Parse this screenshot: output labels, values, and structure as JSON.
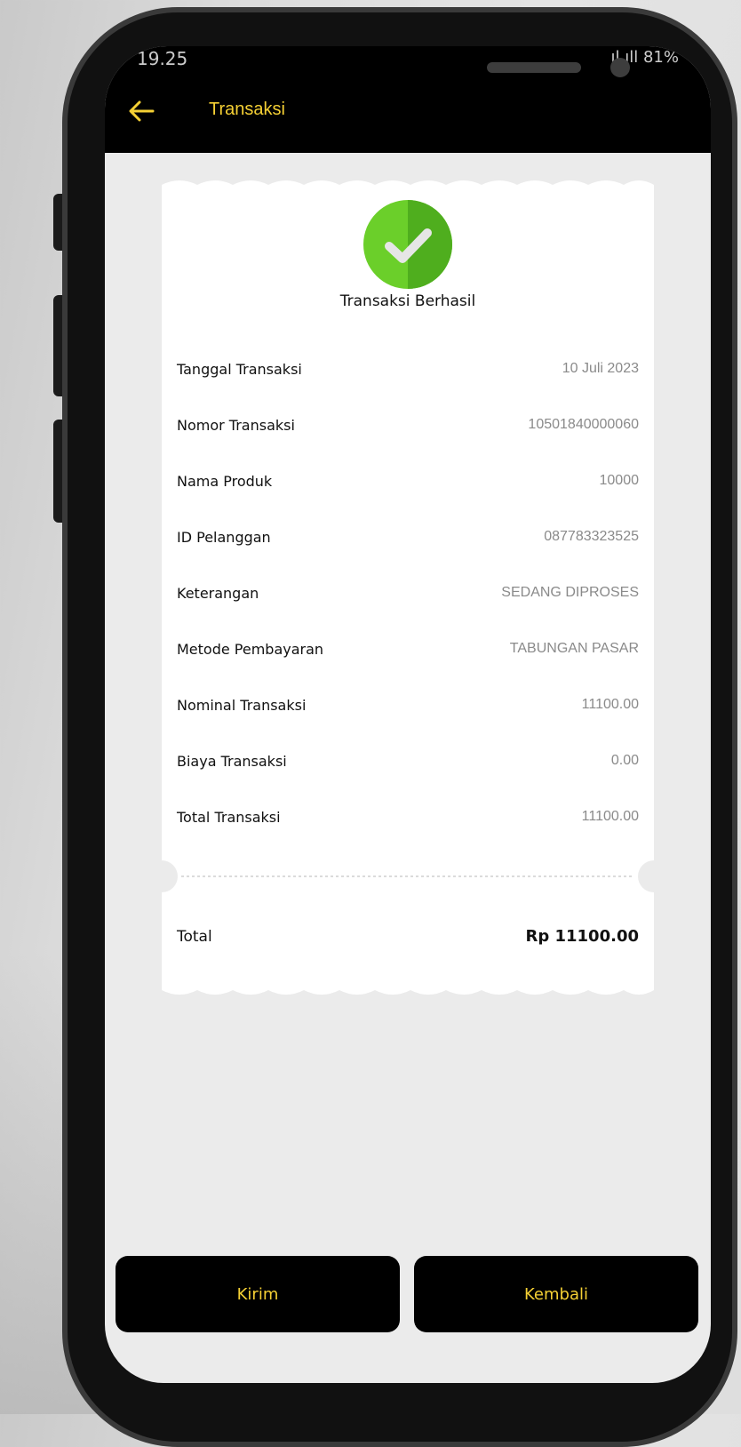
{
  "status_bar": {
    "time": "19.25",
    "signal_battery": "ıl ıll 81%"
  },
  "appbar": {
    "title": "Transaksi",
    "back_icon": "arrow-left-icon"
  },
  "receipt": {
    "status_icon": "check-circle-icon",
    "title": "Transaksi Berhasil",
    "rows": [
      {
        "label": "Tanggal Transaksi",
        "value": "10 Juli 2023"
      },
      {
        "label": "Nomor Transaksi",
        "value": "10501840000060"
      },
      {
        "label": "Nama Produk",
        "value": "10000"
      },
      {
        "label": "ID Pelanggan",
        "value": "087783323525"
      },
      {
        "label": "Keterangan",
        "value": "SEDANG DIPROSES"
      },
      {
        "label": "Metode Pembayaran",
        "value": "TABUNGAN PASAR"
      },
      {
        "label": "Nominal Transaksi",
        "value": "11100.00"
      },
      {
        "label": "Biaya Transaksi",
        "value": "0.00"
      },
      {
        "label": "Total Transaksi",
        "value": "11100.00"
      }
    ],
    "total_label": "Total",
    "total_value": "Rp 11100.00"
  },
  "buttons": {
    "send": "Kirim",
    "back": "Kembali"
  },
  "colors": {
    "accent": "#f5d034",
    "success": "#5cb82e",
    "bar": "#000000",
    "screen_bg": "#ebebeb",
    "card": "#ffffff"
  }
}
